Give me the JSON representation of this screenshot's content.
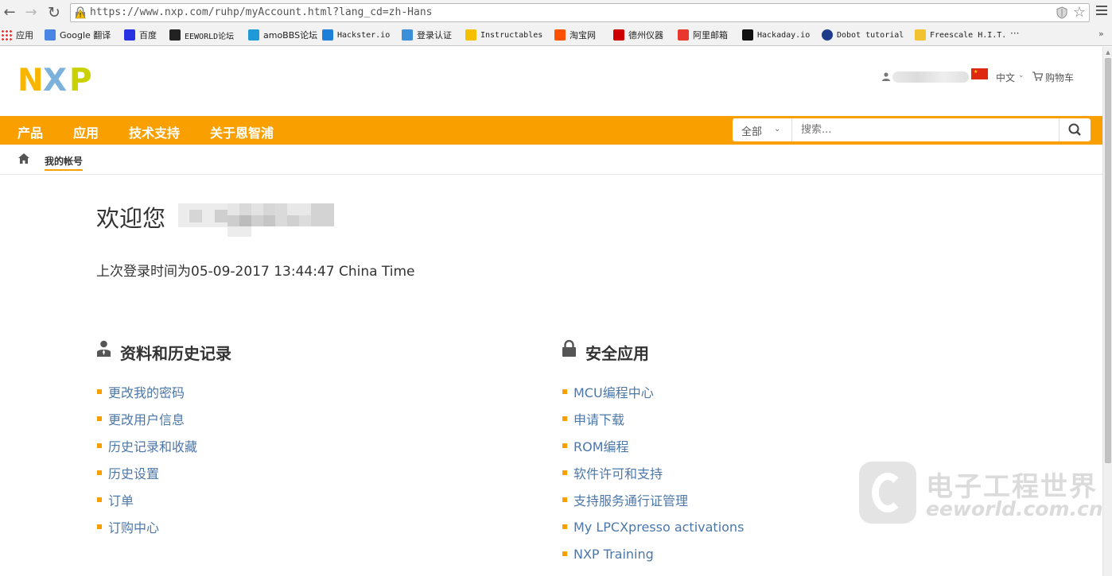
{
  "browser": {
    "url": "https://www.nxp.com/ruhp/myAccount.html?lang_cd=zh-Hans",
    "bookmarks": [
      {
        "label": "应用",
        "icon": "apps-grid-icon"
      },
      {
        "label": "Google 翻译",
        "icon": "google-translate-icon"
      },
      {
        "label": "百度",
        "icon": "baidu-icon"
      },
      {
        "label": "EEWORLD论坛",
        "icon": "eeworld-icon"
      },
      {
        "label": "amoBBS论坛",
        "icon": "amobbs-icon"
      },
      {
        "label": "Hackster.io",
        "icon": "hackster-icon"
      },
      {
        "label": "登录认证",
        "icon": "mail-icon"
      },
      {
        "label": "Instructables",
        "icon": "instructables-icon"
      },
      {
        "label": "淘宝网",
        "icon": "taobao-icon"
      },
      {
        "label": "德州仪器",
        "icon": "ti-icon"
      },
      {
        "label": "阿里邮箱",
        "icon": "aliyun-mail-icon"
      },
      {
        "label": "Hackaday.io",
        "icon": "hackaday-icon"
      },
      {
        "label": "Dobot tutorial",
        "icon": "dobot-icon"
      },
      {
        "label": "Freescale H.I.T.",
        "icon": "freescale-icon"
      }
    ],
    "more": "···"
  },
  "header": {
    "logo": {
      "n": "N",
      "x": "X",
      "p": "P"
    },
    "language": "中文",
    "cart": "购物车"
  },
  "nav": {
    "items": [
      "产品",
      "应用",
      "技术支持",
      "关于恩智浦"
    ],
    "search_category": "全部",
    "search_placeholder": "搜索..."
  },
  "breadcrumb": {
    "current": "我的帐号"
  },
  "main": {
    "welcome": "欢迎您",
    "last_login": "上次登录时间为05-09-2017 13:44:47 China Time"
  },
  "profile": {
    "title": "资料和历史记录",
    "links": [
      "更改我的密码",
      "更改用户信息",
      "历史记录和收藏",
      "历史设置",
      "订单",
      "订购中心"
    ]
  },
  "security": {
    "title": "安全应用",
    "links": [
      "MCU编程中心",
      "申请下载",
      "ROM编程",
      "软件许可和支持",
      "支持服务通行证管理",
      "My LPCXpresso activations",
      "NXP Training"
    ]
  },
  "watermark": {
    "cn": "电子工程世界",
    "en": "eeworld.com.cn"
  },
  "colors": {
    "accent": "#f9a000",
    "link": "#4c77a9",
    "nxp_yellow": "#f9b500",
    "nxp_blue": "#7bb1db",
    "nxp_green": "#c9d200"
  }
}
